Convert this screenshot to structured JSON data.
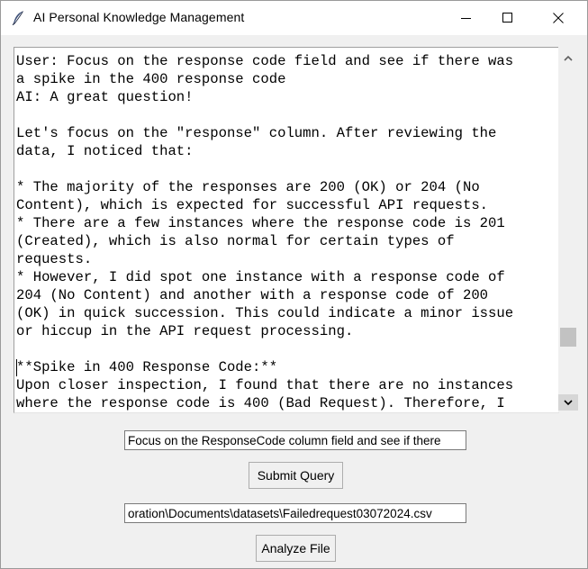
{
  "window": {
    "title": "AI Personal Knowledge Management",
    "icon": "feather-icon"
  },
  "output": {
    "lines": [
      "User: Focus on the response code field and see if there was",
      "a spike in the 400 response code",
      "AI: A great question!",
      "",
      "Let's focus on the \"response\" column. After reviewing the",
      "data, I noticed that:",
      "",
      "* The majority of the responses are 200 (OK) or 204 (No",
      "Content), which is expected for successful API requests.",
      "* There are a few instances where the response code is 201",
      "(Created), which is also normal for certain types of",
      "requests.",
      "* However, I did spot one instance with a response code of",
      "204 (No Content) and another with a response code of 200",
      "(OK) in quick succession. This could indicate a minor issue",
      "or hiccup in the API request processing.",
      "",
      "**Spike in 400 Response Code:**",
      "Upon closer inspection, I found that there are no instances",
      "where the response code is 400 (Bad Request). Therefore, I"
    ],
    "scroll_position": 0.85
  },
  "query": {
    "value": "Focus on the ResponseCode column field and see if there"
  },
  "submit": {
    "label": "Submit Query"
  },
  "file": {
    "value": "oration\\Documents\\datasets\\Failedrequest03072024.csv"
  },
  "analyze": {
    "label": "Analyze File"
  }
}
